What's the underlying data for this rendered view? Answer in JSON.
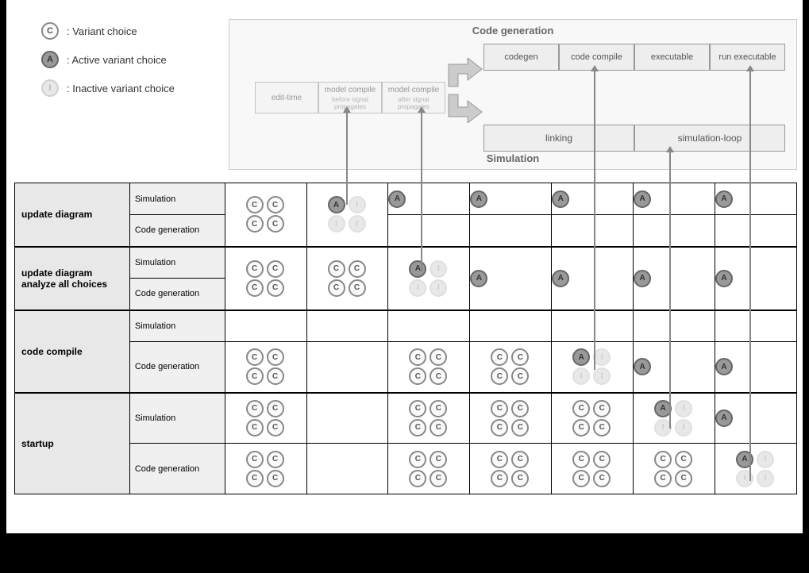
{
  "legend": {
    "c": "C",
    "c_label": ": Variant choice",
    "a": "A",
    "a_label": ": Active variant choice",
    "i": "I",
    "i_label": ": Inactive variant choice"
  },
  "top": {
    "cg_title": "Code generation",
    "sim_title": "Simulation",
    "cg_boxes": [
      "codegen",
      "code compile",
      "executable",
      "run executable"
    ],
    "model_boxes": [
      {
        "main": "edit-time",
        "sub": ""
      },
      {
        "main": "model compile",
        "sub": "before signal propagates"
      },
      {
        "main": "model compile",
        "sub": "after signal propagates"
      }
    ],
    "sim_boxes": [
      "linking",
      "simulation-loop"
    ]
  },
  "rows": [
    {
      "name": "update diagram",
      "sub": [
        "Simulation",
        "Code generation"
      ]
    },
    {
      "name": "update diagram analyze all choices",
      "sub": [
        "Simulation",
        "Code generation"
      ]
    },
    {
      "name": "code compile",
      "sub": [
        "Simulation",
        "Code generation"
      ]
    },
    {
      "name": "startup",
      "sub": [
        "Simulation",
        "Code generation"
      ]
    }
  ],
  "glyphs": {
    "c": "C",
    "a": "A",
    "i": "I"
  },
  "grid": {
    "r1_sim": [
      "4c_merge",
      "ai_ii_merge",
      "a",
      "a",
      "a",
      "a",
      "a"
    ],
    "r1_cg": [
      "merge",
      "merge",
      "",
      "",
      "",
      "",
      ""
    ],
    "r2_sim": [
      "4c",
      "4c",
      "ai_ii",
      "a_span",
      "a_span",
      "a_span",
      "a_span"
    ],
    "r2_cg": [
      "merge",
      "merge",
      "merge",
      "",
      "",
      "",
      ""
    ],
    "r3_sim": [
      "",
      "",
      "",
      "",
      "",
      "",
      ""
    ],
    "r3_cg": [
      "4c",
      "",
      "4c",
      "4c",
      "ai_ii",
      "a",
      "a"
    ],
    "r4_sim": [
      "4c",
      "",
      "4c",
      "4c",
      "4c",
      "ai_ii",
      "a"
    ],
    "r4_cg": [
      "4c",
      "",
      "4c",
      "4c",
      "4c",
      "4c",
      "ai_ii"
    ]
  }
}
